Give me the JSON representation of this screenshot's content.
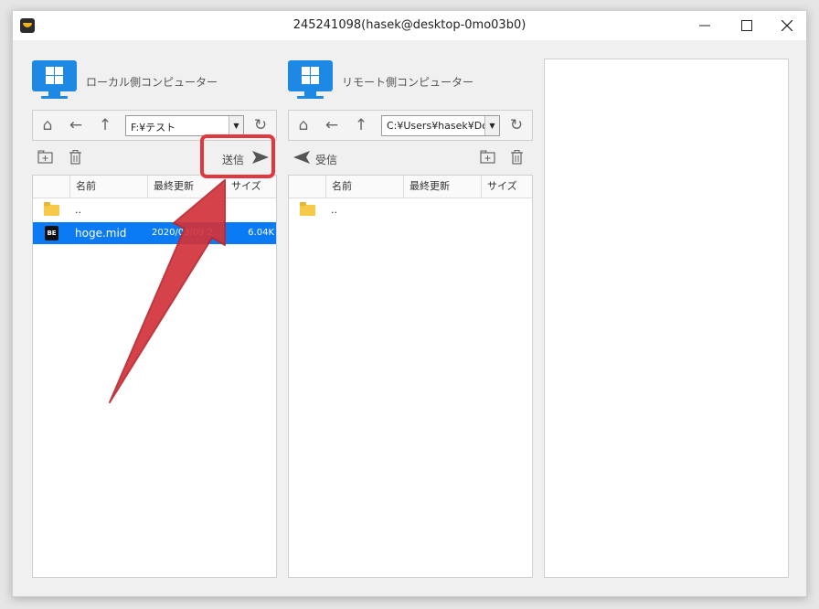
{
  "window": {
    "title": "245241098(hasek@desktop-0mo03b0)",
    "minimize_icon": "minimize-icon",
    "maximize_icon": "maximize-icon",
    "close_icon": "close-icon"
  },
  "local": {
    "label": "ローカル側コンピューター",
    "path": "F:¥テスト",
    "send_label": "送信",
    "columns": [
      "名前",
      "最終更新",
      "サイズ"
    ],
    "rows": [
      {
        "icon": "folder-icon",
        "name": "..",
        "modified": "",
        "size": ""
      },
      {
        "icon": "midi-file-icon",
        "icon_text": "BE",
        "name": "hoge.mid",
        "modified": "2020/03/09 2...",
        "size": "6.04K",
        "selected": true
      }
    ]
  },
  "remote": {
    "label": "リモート側コンピューター",
    "path": "C:¥Users¥hasek¥Do",
    "receive_label": "受信",
    "columns": [
      "名前",
      "最終更新",
      "サイズ"
    ],
    "rows": [
      {
        "icon": "folder-icon",
        "name": ".."
      }
    ]
  },
  "colors": {
    "accent": "#1e88e5",
    "selection": "#0a7af5",
    "annotation": "#e0383e"
  }
}
